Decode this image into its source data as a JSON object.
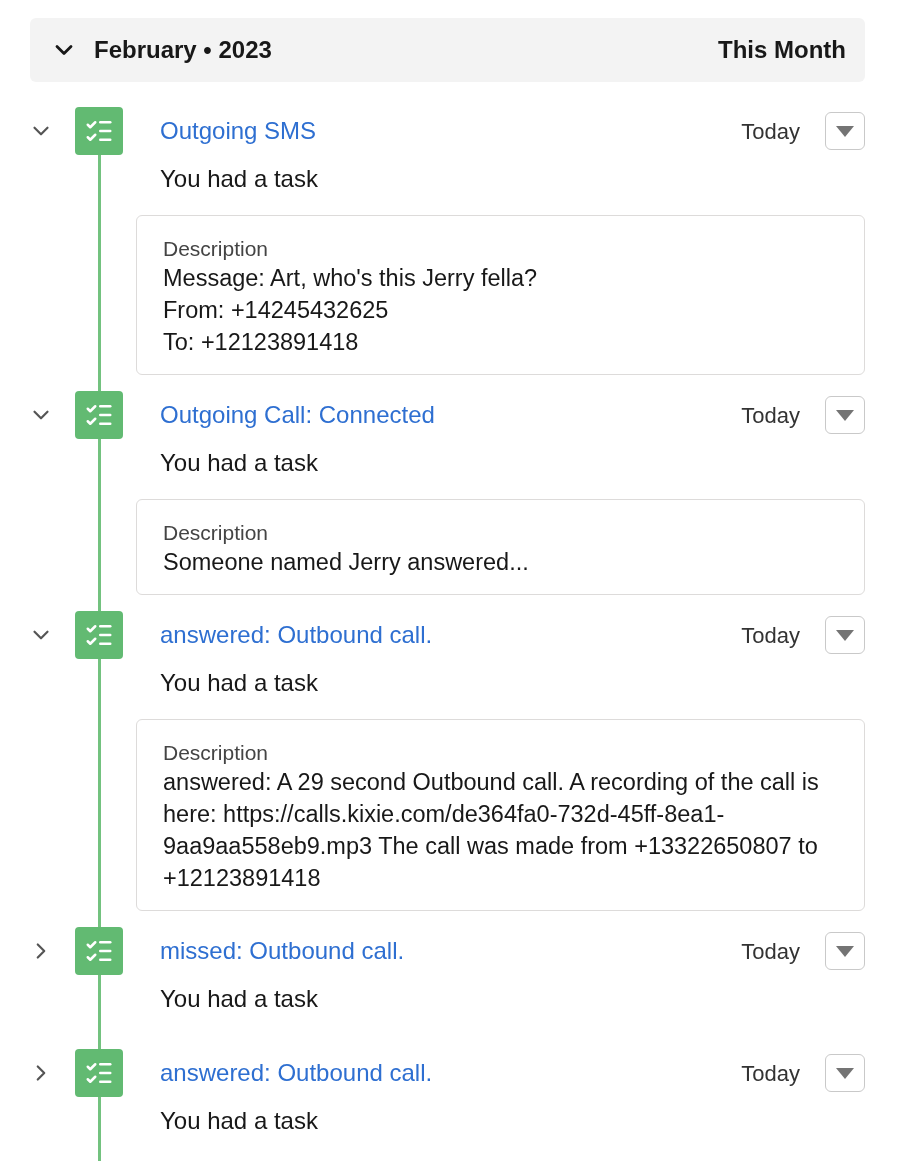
{
  "header": {
    "title": "February • 2023",
    "period": "This Month",
    "expanded": true
  },
  "items": [
    {
      "expanded": true,
      "title": "Outgoing SMS",
      "date": "Today",
      "subtitle": "You had a task",
      "description": {
        "label": "Description",
        "lines": [
          "Message: Art, who's this Jerry fella?",
          "From: +14245432625",
          "To: +12123891418"
        ]
      }
    },
    {
      "expanded": true,
      "title": "Outgoing Call: Connected",
      "date": "Today",
      "subtitle": "You had a task",
      "description": {
        "label": "Description",
        "lines": [
          "Someone named Jerry answered..."
        ]
      }
    },
    {
      "expanded": true,
      "title": "answered: Outbound call.",
      "date": "Today",
      "subtitle": "You had a task",
      "description": {
        "label": "Description",
        "lines": [
          "answered: A 29 second Outbound call. A recording of the call is here: https://calls.kixie.com/de364fa0-732d-45ff-8ea1-9aa9aa558eb9.mp3 The call was made from +13322650807 to +12123891418"
        ]
      }
    },
    {
      "expanded": false,
      "title": "missed: Outbound call.",
      "date": "Today",
      "subtitle": "You had a task"
    },
    {
      "expanded": false,
      "title": "answered: Outbound call.",
      "date": "Today",
      "subtitle": "You had a task"
    }
  ]
}
